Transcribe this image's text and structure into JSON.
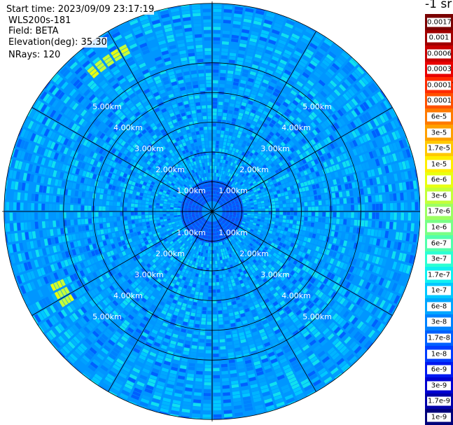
{
  "info": {
    "start_time": "Start time: 2023/09/09 23:17:19",
    "instrument": "WLS200s-181",
    "field": "Field: BETA",
    "elevation": "Elevation(deg): 35.30",
    "nrays": "NRays: 120"
  },
  "colorbar": {
    "unit_label": "-1 sr",
    "levels": [
      {
        "label": "0.0017",
        "color": "#7a0000"
      },
      {
        "label": "0.001",
        "color": "#a00000"
      },
      {
        "label": "0.0006",
        "color": "#c80000"
      },
      {
        "label": "0.0003",
        "color": "#e80000"
      },
      {
        "label": "0.00017",
        "color": "#ff2a00"
      },
      {
        "label": "0.0001",
        "color": "#ff5000"
      },
      {
        "label": "6e-5",
        "color": "#ff7a00"
      },
      {
        "label": "3e-5",
        "color": "#ffa000"
      },
      {
        "label": "1.7e-5",
        "color": "#ffc800"
      },
      {
        "label": "1e-5",
        "color": "#ffee00"
      },
      {
        "label": "6e-6",
        "color": "#e8ff10"
      },
      {
        "label": "3e-6",
        "color": "#c4ff3a"
      },
      {
        "label": "1.7e-6",
        "color": "#9cff62"
      },
      {
        "label": "1e-6",
        "color": "#78ff86"
      },
      {
        "label": "6e-7",
        "color": "#52ffac"
      },
      {
        "label": "3e-7",
        "color": "#2cffd2"
      },
      {
        "label": "1.7e-7",
        "color": "#10f0f0"
      },
      {
        "label": "1e-7",
        "color": "#00c8ff"
      },
      {
        "label": "6e-8",
        "color": "#00a6ff"
      },
      {
        "label": "3e-8",
        "color": "#0082ff"
      },
      {
        "label": "1.7e-8",
        "color": "#0060ff"
      },
      {
        "label": "1e-8",
        "color": "#003cff"
      },
      {
        "label": "6e-9",
        "color": "#0018f0"
      },
      {
        "label": "3e-9",
        "color": "#0000d0"
      },
      {
        "label": "1.7e-9",
        "color": "#0000a8"
      },
      {
        "label": "1e-9",
        "color": "#00007a"
      }
    ]
  },
  "chart_data": {
    "type": "heatmap",
    "projection": "polar PPI",
    "field": "BETA",
    "n_rays": 120,
    "range_rings_km": [
      1,
      2,
      3,
      4,
      5
    ],
    "range_ring_labels": [
      "1.00km",
      "2.00km",
      "3.00km",
      "4.00km",
      "5.00km"
    ],
    "azimuth_spokes_deg": [
      0,
      30,
      60,
      90,
      120,
      150,
      180,
      210,
      240,
      270,
      300,
      330
    ],
    "max_range_km": 7.0,
    "dominant_value_range": [
      3e-08,
      1.7e-07
    ],
    "features": [
      {
        "description": "enhanced backscatter arc",
        "azimuth_deg": [
          235,
          245
        ],
        "range_km": [
          5.4,
          5.9
        ],
        "approx_value": 6e-06
      },
      {
        "description": "enhanced backscatter arc",
        "azimuth_deg": [
          318,
          330
        ],
        "range_km": [
          5.9,
          6.3
        ],
        "approx_value": 6e-06
      }
    ]
  }
}
